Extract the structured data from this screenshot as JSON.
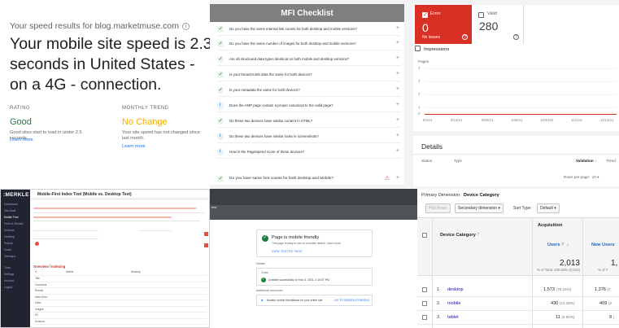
{
  "speed": {
    "source": "Your speed results for blog.marketmuse.com",
    "headline": "Your mobile site speed is 2.3 seconds in United States - on a 4G - connection.",
    "rating_label": "RATING",
    "rating_value": "Good",
    "rating_desc": "Good sites start to load in under 2.5 seconds.",
    "rating_link": "Learn more",
    "trend_label": "MONTHLY TREND",
    "trend_value": "No Change",
    "trend_desc": "Your site speed has not changed since last month.",
    "trend_link": "Learn more",
    "colors": {
      "good": "#188038",
      "nochange": "#f9ab00"
    }
  },
  "checklist": {
    "title": "MFI Checklist",
    "items": [
      {
        "text": "Do you have the same internal link counts for both desktop and mobile versions?",
        "icon": "check-icon"
      },
      {
        "text": "Do you have the same number of images for both desktop and mobile versions?",
        "icon": "check-icon"
      },
      {
        "text": "Are all structured data types identical on both mobile and desktop versions?",
        "icon": "check-icon"
      },
      {
        "text": "Is your breadcrumb data the same for both devices?",
        "icon": "check-icon"
      },
      {
        "text": "Is your metadata the same for both devices?",
        "icon": "check-icon"
      },
      {
        "text": "Does the AMP page contain a proper canonical to the valid page?",
        "icon": "info-icon"
      },
      {
        "text": "Do these two devices have similar content in HTML?",
        "icon": "check-icon"
      },
      {
        "text": "Do these two devices have similar looks in screenshots?",
        "icon": "info-icon"
      },
      {
        "text": "How is the PageSpeed score of these devices?",
        "icon": "info-icon"
      }
    ],
    "footer_item": "Do you have same font counts for both desktop and Mobile?",
    "plus": "+"
  },
  "coverage": {
    "error_label": "Error",
    "error_count": "0",
    "error_sub": "No issues",
    "valid_label": "Valid",
    "valid_count": "280",
    "impressions_label": "Impressions",
    "pages_label": "Pages",
    "y_ticks": [
      "4",
      "3",
      "2",
      "1",
      "0"
    ],
    "x_ticks": [
      "9/2/21",
      "9/14/21",
      "9/26/21",
      "10/8/21",
      "10/20/21",
      "11/1/21",
      "11/13/21"
    ],
    "colors": {
      "error": "#d93025"
    }
  },
  "details": {
    "title": "Details",
    "columns": [
      "Status",
      "Type",
      "Validation",
      "Trend"
    ],
    "rows_per_page_label": "Rows per page:",
    "rows_per_page_value": "10"
  },
  "merkle": {
    "logo": ":MERKLE",
    "title": "Mobile-First Index Tool (Mobile vs. Desktop Test)",
    "nav": [
      "Dashboard",
      "Site Audit",
      "Mobile First",
      "Fetch & Render",
      "Schema",
      "Hreflang",
      "Robots",
      "Crawl",
      "Sitemaps",
      "Tools",
      "Settings",
      "Account",
      "Logout"
    ],
    "section": "Overview / Indexing",
    "table_cols": [
      "#",
      "Mobile",
      "Desktop"
    ],
    "table_rows": [
      "Title",
      "Canonical",
      "Robots",
      "Meta Desc",
      "Links",
      "Images",
      "H1",
      "Schema",
      "Font Count",
      "Word Count",
      "Hreflang"
    ]
  },
  "mobile_test": {
    "header_text": "test",
    "card_title": "Page is mobile friendly",
    "card_sub": "This page is easy to use on a mobile device. Learn more",
    "card_button": "VIEW TESTED PAGE",
    "details_label": "Details",
    "crawl_label": "Crawl",
    "crawl_text": "Crawled successfully on Nov 3, 2021, 1:15:07 PM",
    "additional_label": "Additional resources",
    "additional_text": "Monitor mobile friendliness for your entire site",
    "additional_link": "GO TO SEARCH CONSOLE"
  },
  "analytics": {
    "primary_dimension_label": "Primary Dimension:",
    "primary_dimension_value": "Device Category",
    "plot_rows": "Plot Rows",
    "secondary_dimension": "Secondary dimension",
    "sort_type_label": "Sort Type:",
    "sort_type_value": "Default",
    "acquisition": "Acquisition",
    "col_device": "Device Category",
    "col_users": "Users",
    "col_new_users": "New Users",
    "total_users": "2,013",
    "total_users_sub": "% of Total: 100.00% (2,013)",
    "total_new": "1,",
    "total_new_sub": "% of T",
    "rows": [
      {
        "n": "1.",
        "label": "desktop",
        "users": "1,573",
        "users_pct": "(78.15%)",
        "new": "1,376",
        "new_pct": "(7"
      },
      {
        "n": "2.",
        "label": "mobile",
        "users": "430",
        "users_pct": "(21.35%)",
        "new": "409",
        "new_pct": "(2"
      },
      {
        "n": "3.",
        "label": "tablet",
        "users": "11",
        "users_pct": "(0.55%)",
        "new": "9",
        "new_pct": "("
      }
    ]
  }
}
